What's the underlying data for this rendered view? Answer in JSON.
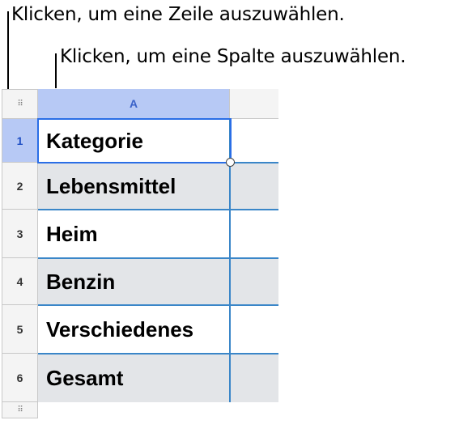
{
  "callouts": {
    "row": "Klicken, um eine Zeile auszuwählen.",
    "column": "Klicken, um eine Spalte auszuwählen."
  },
  "grid": {
    "column_header": "A",
    "corner_icon": "grip-dots-icon",
    "footer_icon": "grip-dots-icon",
    "rows": [
      {
        "number": "1",
        "value": "Kategorie"
      },
      {
        "number": "2",
        "value": "Lebensmittel"
      },
      {
        "number": "3",
        "value": "Heim"
      },
      {
        "number": "4",
        "value": "Benzin"
      },
      {
        "number": "5",
        "value": "Verschiedenes"
      },
      {
        "number": "6",
        "value": "Gesamt"
      }
    ]
  },
  "colors": {
    "selection_header": "#b7c9f5",
    "selection_border": "#2a6ee6",
    "grid_line": "#3a86c8",
    "alt_row": "#e3e5e8"
  }
}
